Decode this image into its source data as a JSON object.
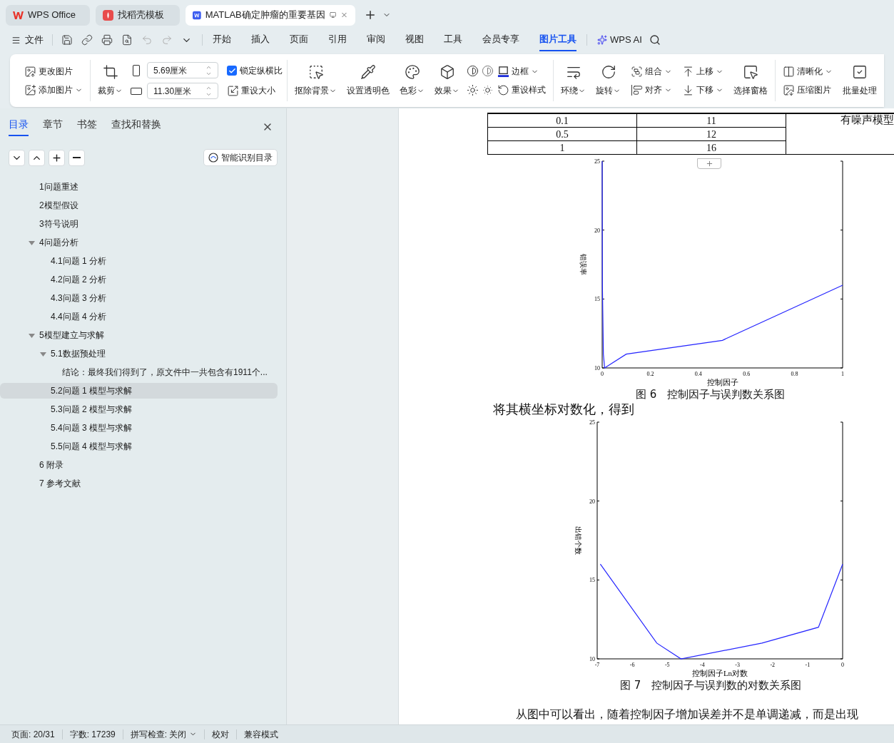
{
  "tabs": [
    {
      "label": "WPS Office",
      "selected": false
    },
    {
      "label": "找稻壳模板",
      "selected": false
    },
    {
      "label": "MATLAB确定肿瘤的重要基因",
      "selected": true
    }
  ],
  "menu": {
    "file": "文件",
    "items": [
      {
        "label": "开始",
        "selected": false
      },
      {
        "label": "插入",
        "selected": false
      },
      {
        "label": "页面",
        "selected": false
      },
      {
        "label": "引用",
        "selected": false
      },
      {
        "label": "审阅",
        "selected": false
      },
      {
        "label": "视图",
        "selected": false
      },
      {
        "label": "工具",
        "selected": false
      },
      {
        "label": "会员专享",
        "selected": false
      },
      {
        "label": "图片工具",
        "selected": true
      }
    ],
    "ai": "WPS AI"
  },
  "ribbon": {
    "groups": [
      {
        "columns": [
          {
            "kind": "stack",
            "items": [
              {
                "label": "更改图片",
                "dropdown": false
              },
              {
                "label": "添加图片",
                "dropdown": true
              }
            ]
          }
        ]
      },
      {
        "columns": [
          {
            "kind": "big",
            "label": "裁剪",
            "dropdown": true
          },
          {
            "kind": "size",
            "fields": [
              {
                "value": "5.69厘米"
              },
              {
                "value": "11.30厘米"
              }
            ]
          },
          {
            "kind": "lock",
            "checkbox": {
              "label": "锁定纵横比",
              "checked": true
            },
            "button": "重设大小"
          }
        ]
      },
      {
        "columns": [
          {
            "kind": "big",
            "label": "抠除背景",
            "dropdown": true
          },
          {
            "kind": "big",
            "label": "设置透明色",
            "dropdown": false
          },
          {
            "kind": "big",
            "label": "色彩",
            "dropdown": true
          },
          {
            "kind": "big",
            "label": "效果",
            "dropdown": true
          },
          {
            "kind": "icon_grid"
          },
          {
            "kind": "stack",
            "items": [
              {
                "label": "边框",
                "dropdown": true
              },
              {
                "label": "重设样式",
                "dropdown": false
              }
            ]
          }
        ]
      },
      {
        "columns": [
          {
            "kind": "big",
            "label": "环绕",
            "dropdown": true
          },
          {
            "kind": "big",
            "label": "旋转",
            "dropdown": true
          },
          {
            "kind": "stack",
            "items": [
              {
                "label": "组合",
                "dropdown": true
              },
              {
                "label": "对齐",
                "dropdown": true
              }
            ]
          },
          {
            "kind": "stack",
            "items": [
              {
                "label": "上移",
                "dropdown": true
              },
              {
                "label": "下移",
                "dropdown": true
              }
            ]
          },
          {
            "kind": "big",
            "label": "选择窗格",
            "dropdown": false
          }
        ]
      },
      {
        "columns": [
          {
            "kind": "stack",
            "items": [
              {
                "label": "清晰化",
                "dropdown": true
              },
              {
                "label": "压缩图片",
                "dropdown": false
              }
            ]
          },
          {
            "kind": "big",
            "label": "批量处理",
            "dropdown": false
          }
        ]
      }
    ]
  },
  "sidebar": {
    "tabs": [
      {
        "label": "目录",
        "selected": true
      },
      {
        "label": "章节",
        "selected": false
      },
      {
        "label": "书签",
        "selected": false
      },
      {
        "label": "查找和替换",
        "selected": false
      }
    ],
    "smart_button": "智能识别目录",
    "outline": [
      {
        "label": "1问题重述",
        "selected": false
      },
      {
        "label": "2模型假设",
        "selected": false
      },
      {
        "label": "3符号说明",
        "selected": false
      },
      {
        "label": "4问题分析",
        "selected": false,
        "expanded": true,
        "children": [
          {
            "label": "4.1问题 1 分析",
            "selected": false
          },
          {
            "label": "4.2问题 2 分析",
            "selected": false
          },
          {
            "label": "4.3问题 3 分析",
            "selected": false
          },
          {
            "label": "4.4问题 4 分析",
            "selected": false
          }
        ]
      },
      {
        "label": "5模型建立与求解",
        "selected": false,
        "expanded": true,
        "children": [
          {
            "label": "5.1数据预处理",
            "selected": false,
            "expanded": true,
            "children": [
              {
                "label": "结论：最终我们得到了，原文件中一共包含有1911个...",
                "selected": false
              }
            ]
          },
          {
            "label": "5.2问题 1 模型与求解",
            "selected": true
          },
          {
            "label": "5.3问题 2 模型与求解",
            "selected": false
          },
          {
            "label": "5.4问题 3 模型与求解",
            "selected": false
          },
          {
            "label": "5.5问题 4 模型与求解",
            "selected": false
          }
        ]
      },
      {
        "label": "6 附录",
        "selected": false
      },
      {
        "label": "7 参考文献",
        "selected": false
      }
    ]
  },
  "document": {
    "table": {
      "rows": [
        [
          "0.1",
          "11"
        ],
        [
          "0.5",
          "12"
        ],
        [
          "1",
          "16"
        ]
      ],
      "side_note": "有噪声模型"
    },
    "figure_6": {
      "chart_data": {
        "type": "line",
        "xlabel": "控制因子",
        "ylabel": "错误率",
        "x": [
          0,
          0.001,
          0.005,
          0.01,
          0.1,
          0.5,
          1
        ],
        "series": [
          {
            "color": "#2525ff",
            "values": [
              25,
              16,
              11,
              10,
              11,
              12,
              16
            ]
          }
        ],
        "xlim": [
          0,
          1
        ],
        "ylim": [
          10,
          25
        ],
        "xticks": [
          0,
          0.2,
          0.4,
          0.6,
          0.8,
          1
        ],
        "yticks": [
          10,
          15,
          20,
          25
        ]
      },
      "caption": "图 6　控制因子与误判数关系图"
    },
    "paragraph_1": "将其横坐标对数化，得到",
    "figure_7": {
      "chart_data": {
        "type": "line",
        "xlabel": "控制因子Ln对数",
        "ylabel": "出错个数",
        "x": [
          -6.91,
          -5.3,
          -4.61,
          -2.3,
          -0.69,
          0
        ],
        "series": [
          {
            "color": "#2525ff",
            "values": [
              16,
              11,
              10,
              11,
              12,
              16
            ]
          }
        ],
        "xlim": [
          -7,
          0
        ],
        "ylim": [
          10,
          25
        ],
        "xticks": [
          -7,
          -6,
          -5,
          -4,
          -3,
          -2,
          -1,
          0
        ],
        "yticks": [
          10,
          15,
          20,
          25
        ]
      },
      "caption": "图 7　控制因子与误判数的对数关系图"
    },
    "paragraph_2": "从图中可以看出，随着控制因子增加误差并不是单调递减，而是出现"
  },
  "status_bar": [
    {
      "label": "页面: 20/31",
      "dropdown": false
    },
    {
      "label": "字数: 17239",
      "dropdown": false
    },
    {
      "label": "拼写检查: 关闭",
      "dropdown": true
    },
    {
      "label": "校对",
      "dropdown": false
    },
    {
      "label": "兼容模式",
      "dropdown": false
    }
  ]
}
